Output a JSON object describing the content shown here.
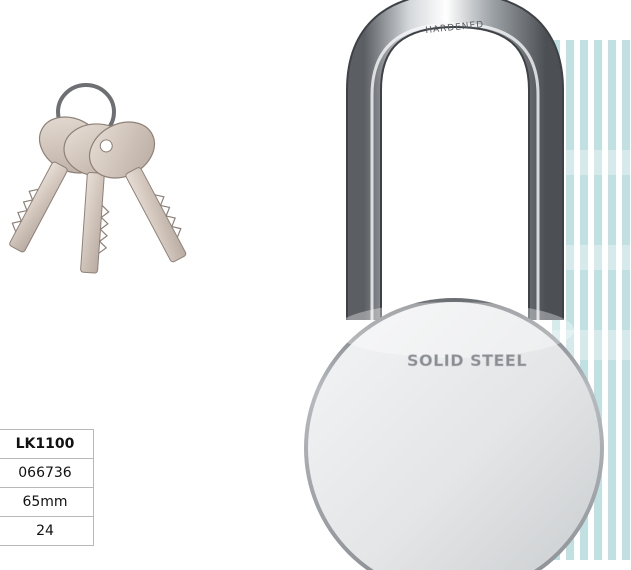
{
  "product_image": {
    "keys_alt": "keys-on-ring",
    "padlock_alt": "solid-steel-padlock",
    "engraving": "SOLID STEEL",
    "shackle_stamp": "HARDENED",
    "watermark_color": "#8fc7cc",
    "steel_color": "#d9dbdd"
  },
  "spec_table": {
    "rows": [
      {
        "value": "LK1100"
      },
      {
        "value": "066736"
      },
      {
        "value": "65mm"
      },
      {
        "value": "24"
      }
    ]
  }
}
